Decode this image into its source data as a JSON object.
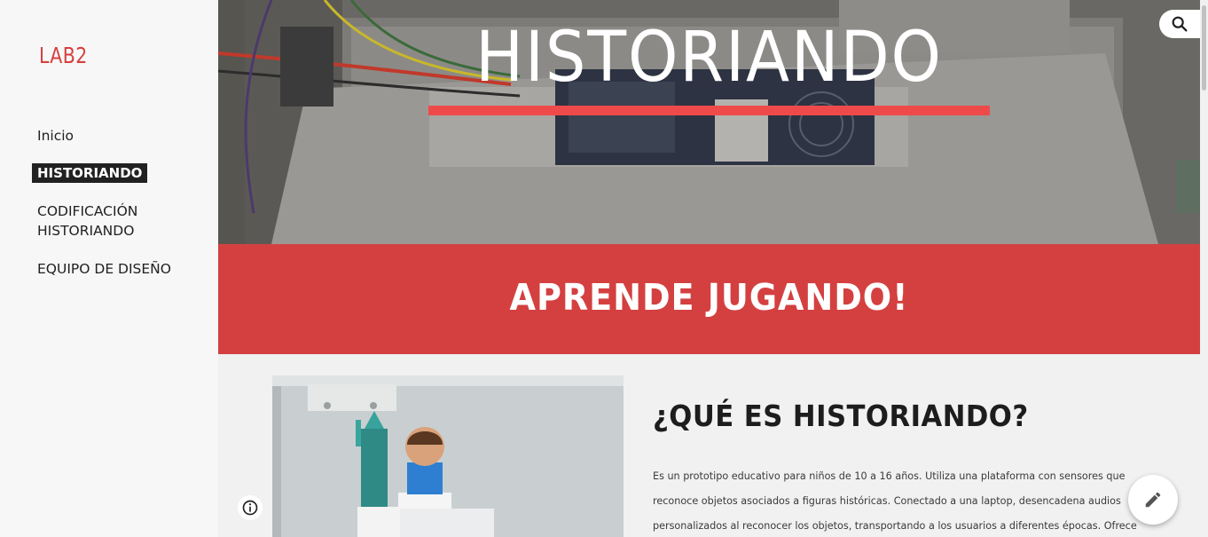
{
  "sidebar": {
    "site_title": "LAB2",
    "nav": [
      {
        "label": "Inicio",
        "active": false
      },
      {
        "label": "HISTORIANDO",
        "active": true
      },
      {
        "label_line1": "CODIFICACIÓN",
        "label_line2": "HISTORIANDO",
        "active": false
      },
      {
        "label": "EQUIPO DE DISEÑO",
        "active": false
      }
    ]
  },
  "hero": {
    "title": "HISTORIANDO",
    "underline_color": "#ef4a4a",
    "image": "rfid-circuit-board-photo"
  },
  "banner": {
    "text": "APRENDE JUGANDO!",
    "color": "#d44040"
  },
  "content": {
    "image": "statue-of-liberty-and-figurine-photo",
    "heading": "¿QUÉ ES HISTORIANDO?",
    "paragraph_lines": [
      "Es un prototipo educativo para niños de 10 a 16 años. Utiliza una plataforma con sensores que",
      "reconoce objetos asociados a figuras históricas. Conectado a una laptop, desencadena audios",
      "personalizados al reconocer los objetos, transportando a los usuarios a diferentes épocas. Ofrece"
    ]
  },
  "controls": {
    "search_icon": "search-icon",
    "edit_icon": "pencil-icon",
    "info_icon": "info-icon"
  }
}
